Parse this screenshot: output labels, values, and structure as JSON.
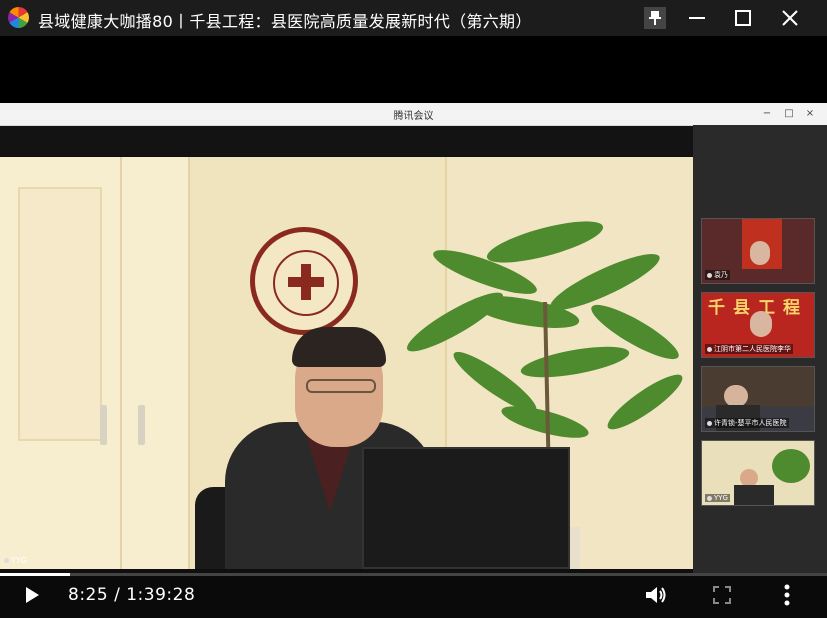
{
  "window": {
    "title": "县域健康大咖播80丨千县工程：县医院高质量发展新时代（第六期）",
    "buttons": {
      "pin": "pin-icon",
      "minimize": "minimize-icon",
      "maximize": "maximize-icon",
      "close": "close-icon"
    }
  },
  "meeting": {
    "title": "腾讯会议",
    "controls": [
      "−",
      "□",
      "×"
    ]
  },
  "participants": [
    {
      "name": "袁乃",
      "bg": "#5a2a2a"
    },
    {
      "name": "江阴市第二人民医院李华",
      "banner": "千县工程",
      "bg": "#b8261f"
    },
    {
      "name": "许青锁-楚平市人民医院",
      "bg": "#3b3b44"
    },
    {
      "name": "YYG",
      "bg": "#e9dfba"
    }
  ],
  "main_video": {
    "speaker_label": "YYG"
  },
  "player": {
    "current_time": "8:25",
    "separator": " / ",
    "duration": "1:39:28",
    "progress": 0.0846
  },
  "colors": {
    "seal": "#8a2a1e",
    "plant": "#4e8a2e"
  }
}
